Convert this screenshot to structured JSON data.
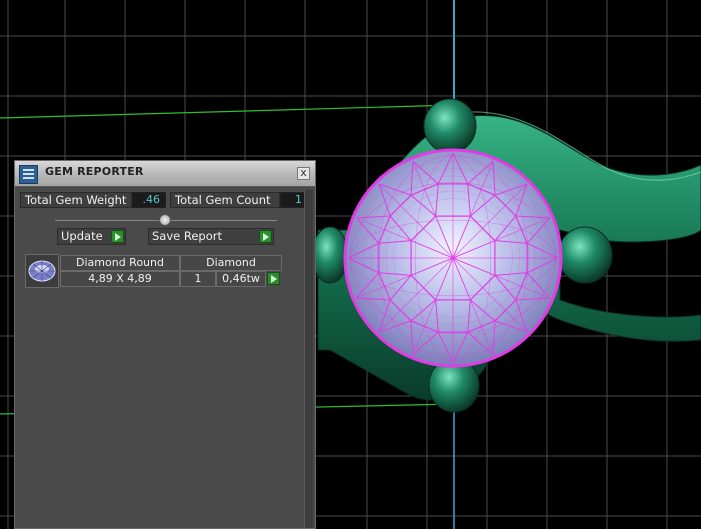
{
  "panel": {
    "title": "GEM REPORTER",
    "close_glyph": "x",
    "total_weight_label": "Total Gem Weight",
    "total_weight_value": ".46",
    "total_count_label": "Total Gem Count",
    "total_count_value": "1",
    "update_label": "Update",
    "save_report_label": "Save Report"
  },
  "gems": [
    {
      "shape": "Diamond Round",
      "size": "4,89 X 4,89",
      "material": "Diamond",
      "count": "1",
      "weight": "0,46tw"
    }
  ],
  "colors": {
    "wireframe": "#e23be6",
    "metal": "#1f8a67",
    "grid": "#4a4a4a",
    "axis_green": "#2fbf2f",
    "axis_blue": "#3aa6c9"
  },
  "icons": {
    "panel": "gem-reporter-icon",
    "close": "close-icon",
    "go": "play-arrow-icon",
    "thumb": "round-gem-icon"
  }
}
